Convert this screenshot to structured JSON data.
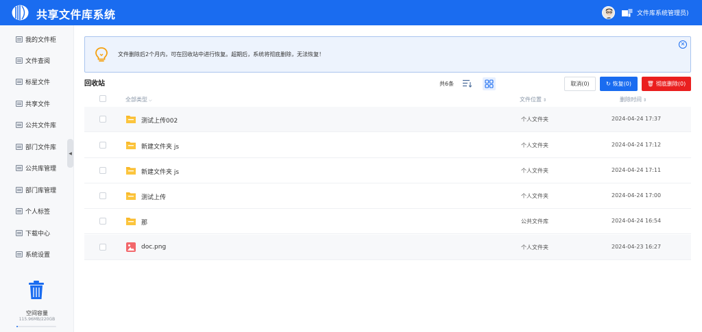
{
  "header": {
    "app_title": "共享文件库系统",
    "user_name": "文件库系统管理员)",
    "brand_color": "#1a6cf0"
  },
  "sidebar": {
    "items": [
      {
        "label": "我的文件柜",
        "icon": "cabinet-icon"
      },
      {
        "label": "文件查阅",
        "icon": "document-icon"
      },
      {
        "label": "标星文件",
        "icon": "star-file-icon"
      },
      {
        "label": "共享文件",
        "icon": "share-icon"
      },
      {
        "label": "公共文件库",
        "icon": "library-icon"
      },
      {
        "label": "部门文件库",
        "icon": "department-icon"
      },
      {
        "label": "公共库管理",
        "icon": "manage-icon"
      },
      {
        "label": "部门库管理",
        "icon": "manage-icon"
      },
      {
        "label": "个人标签",
        "icon": "tag-icon"
      },
      {
        "label": "下载中心",
        "icon": "download-icon"
      },
      {
        "label": "系统设置",
        "icon": "settings-icon"
      }
    ],
    "storage_label": "空间容量",
    "storage_value": "115.96MB/220GB",
    "storage_used_fraction": 0.0005
  },
  "notice": {
    "text": "文件删除后2个月内，可在回收站中进行恢复。超期后，系统将彻底删除，无法恢复！"
  },
  "toolbar": {
    "page_title": "回收站",
    "count_text": "共6条",
    "cancel_label": "取消(0)",
    "restore_label": "恢复(0)",
    "delete_label": "彻底删除(0)"
  },
  "table": {
    "headers": {
      "type": "全部类型",
      "location": "文件位置",
      "deleted_time": "删除时间"
    },
    "rows": [
      {
        "name": "测试上传002",
        "type": "folder",
        "location": "个人文件夹",
        "time": "2024-04-24 17:37"
      },
      {
        "name": "新建文件夹 js",
        "type": "folder",
        "location": "个人文件夹",
        "time": "2024-04-24 17:12"
      },
      {
        "name": "新建文件夹 js",
        "type": "folder",
        "location": "个人文件夹",
        "time": "2024-04-24 17:11"
      },
      {
        "name": "测试上传",
        "type": "folder",
        "location": "个人文件夹",
        "time": "2024-04-24 17:00"
      },
      {
        "name": "那",
        "type": "folder",
        "location": "公共文件库",
        "time": "2024-04-24 16:54"
      },
      {
        "name": "doc.png",
        "type": "image",
        "location": "个人文件夹",
        "time": "2024-04-23 16:27"
      }
    ]
  }
}
